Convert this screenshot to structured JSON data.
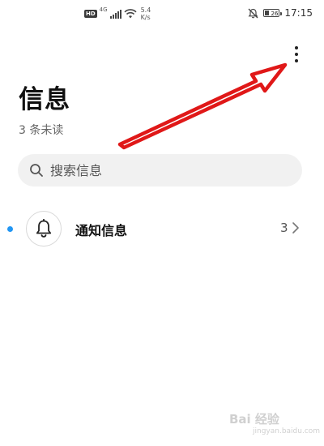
{
  "status_bar": {
    "hd": "HD",
    "network": "4G",
    "speed_value": "5.4",
    "speed_unit": "K/s",
    "battery_level": "26",
    "time": "17:15"
  },
  "header": {
    "title": "信息",
    "unread_summary": "3 条未读",
    "more_icon": "more-vertical-icon"
  },
  "search": {
    "placeholder": "搜索信息",
    "icon": "search-icon"
  },
  "conversations": [
    {
      "title": "通知信息",
      "count": "3",
      "icon": "bell-icon",
      "unread": true
    }
  ],
  "annotation": {
    "color": "#e01818"
  },
  "watermark": {
    "text": "Bai 经验",
    "sub": "jingyan.baidu.com"
  }
}
